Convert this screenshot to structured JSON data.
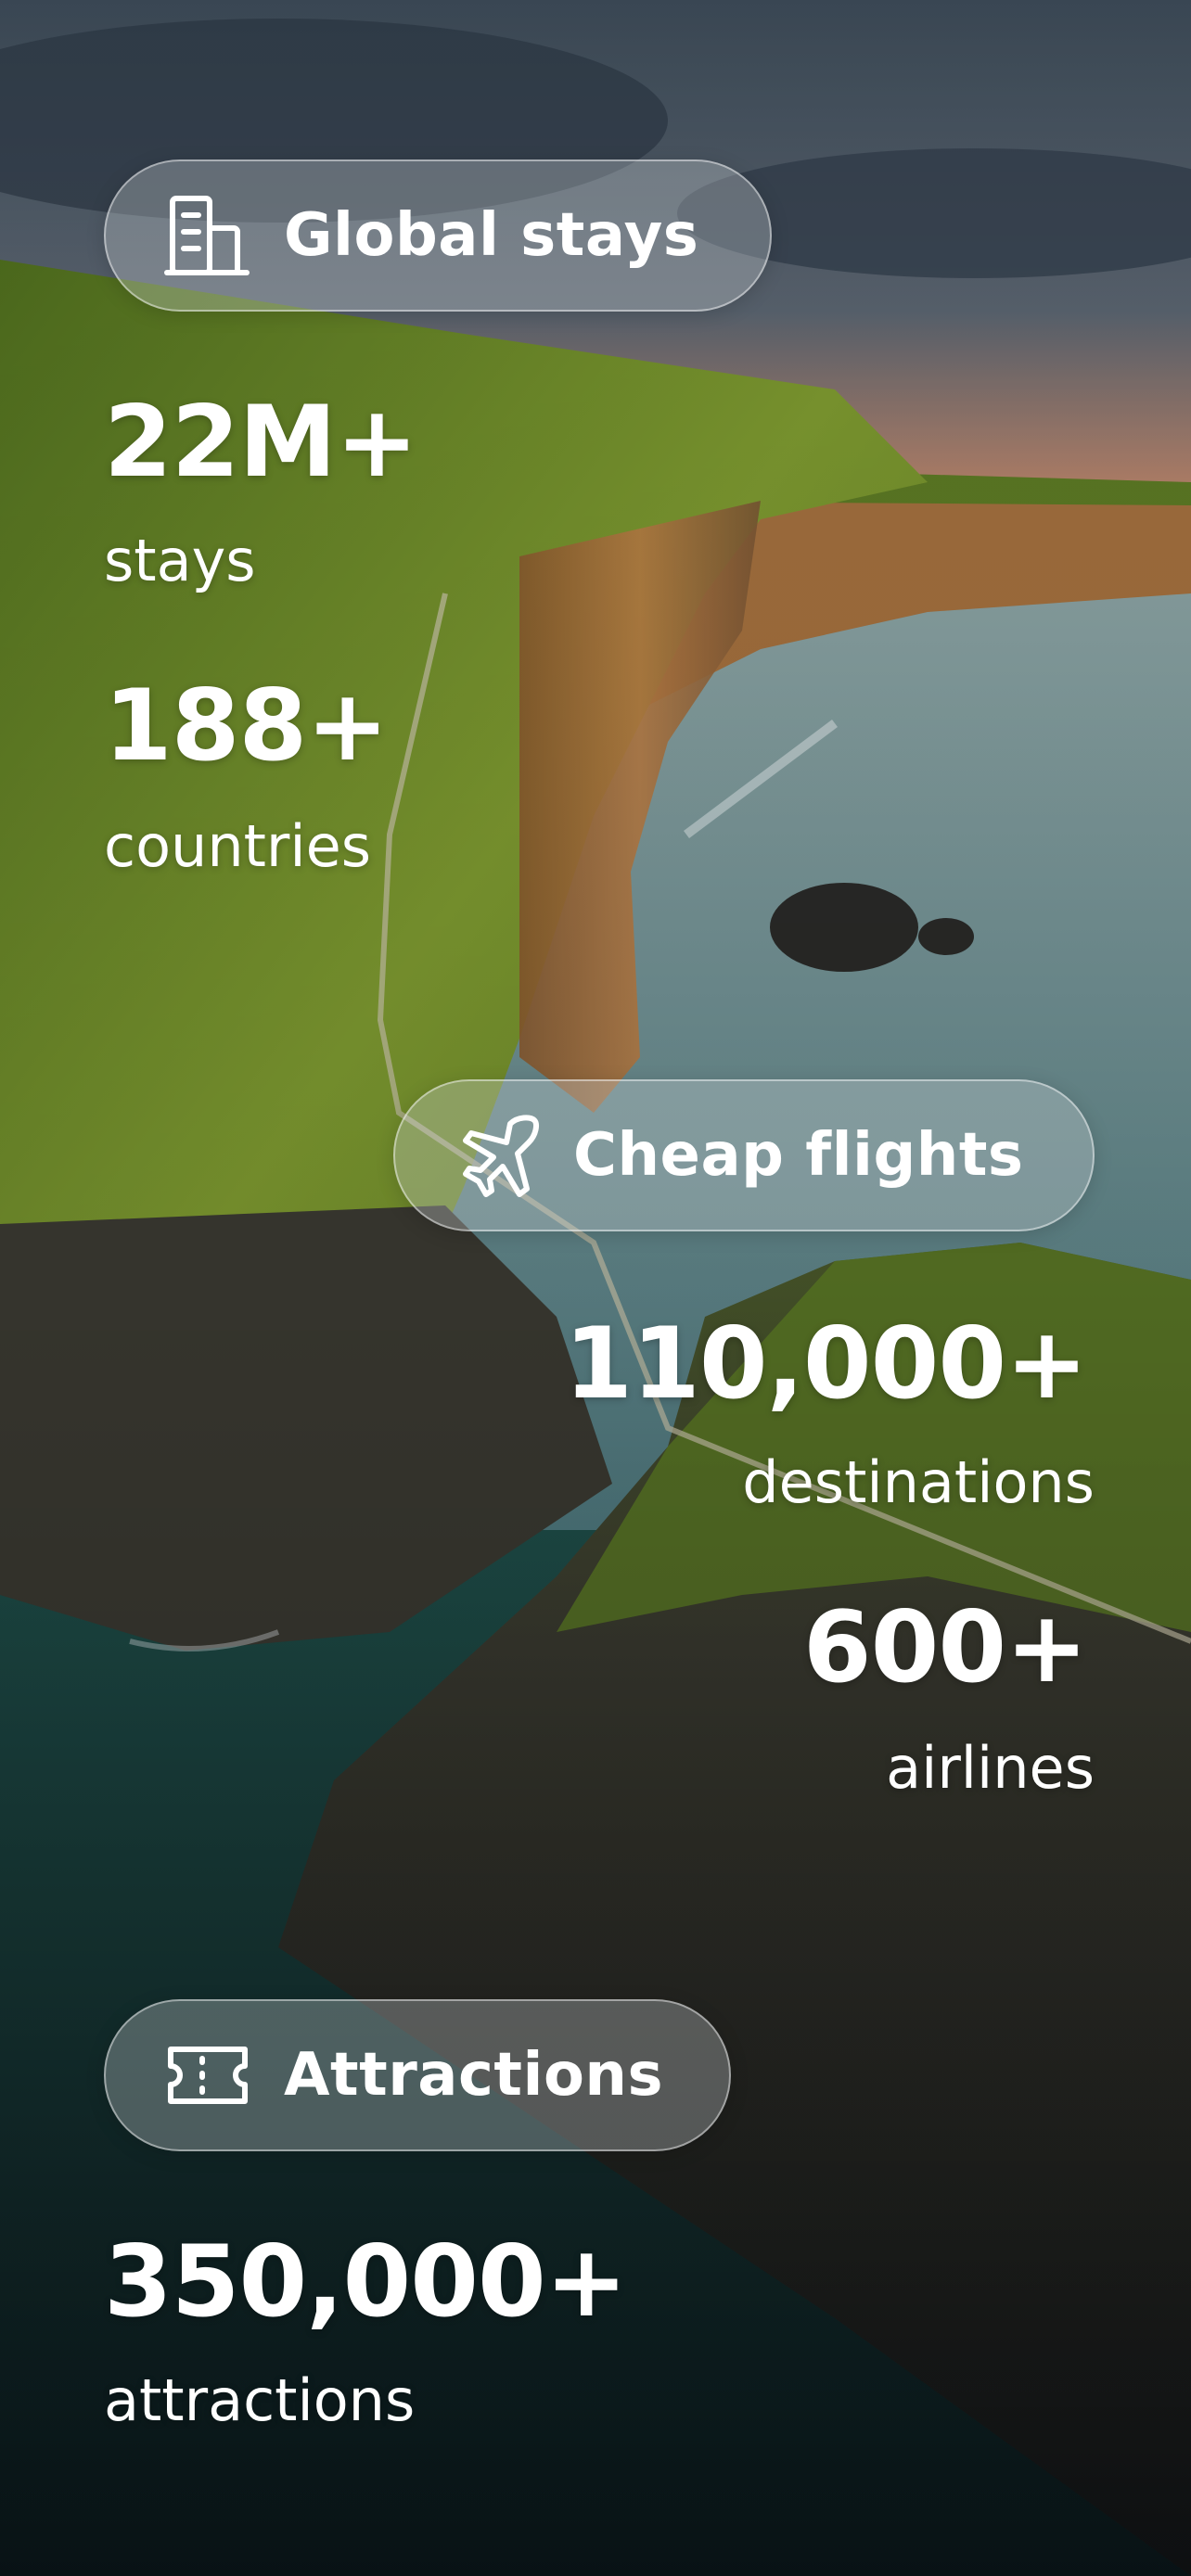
{
  "sections": [
    {
      "title": "Global stays",
      "icon": "building-icon",
      "stats": [
        {
          "value": "22M+",
          "label": "stays"
        },
        {
          "value": "188+",
          "label": "countries"
        }
      ]
    },
    {
      "title": "Cheap flights",
      "icon": "airplane-icon",
      "stats": [
        {
          "value": "110,000+",
          "label": "destinations"
        },
        {
          "value": "600+",
          "label": "airlines"
        }
      ]
    },
    {
      "title": "Attractions",
      "icon": "ticket-icon",
      "stats": [
        {
          "value": "350,000+",
          "label": "attractions"
        }
      ]
    }
  ],
  "colors": {
    "text": "#ffffff",
    "pill_background": "rgba(205,210,215,0.32)",
    "grass": "#6b8a2a",
    "cliff": "#9a6a3a",
    "sea": "#3f6f78",
    "sky": "#4a5866"
  },
  "background": "coastal-cliffs-photo"
}
